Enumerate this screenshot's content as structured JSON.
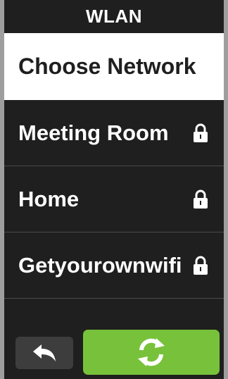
{
  "header": {
    "title": "WLAN"
  },
  "section": {
    "title": "Choose Network"
  },
  "networks": [
    {
      "name": "Meeting Room",
      "icon": "lock-icon"
    },
    {
      "name": "Home",
      "icon": "lock-icon"
    },
    {
      "name": "Getyourownwifi",
      "icon": "lock-icon"
    }
  ],
  "footer": {
    "back_icon": "back-arrow-icon",
    "refresh_icon": "refresh-icon",
    "accent_color": "#77c23a"
  }
}
